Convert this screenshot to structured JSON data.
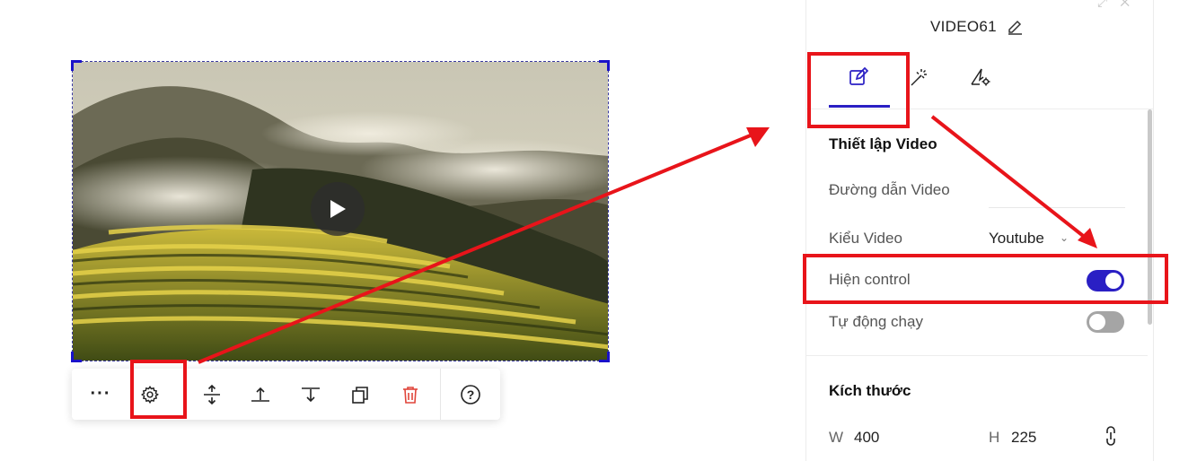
{
  "video_element": {
    "play_icon": "play-icon"
  },
  "toolbar": {
    "icons": [
      "more-icon",
      "gear-icon",
      "move-vertical-icon",
      "align-top-icon",
      "align-bottom-icon",
      "duplicate-icon",
      "trash-icon",
      "help-icon"
    ],
    "more_label": "···",
    "help_label": "?"
  },
  "panel": {
    "title": "VIDEO61",
    "tabs": [
      "edit-icon",
      "magic-wand-icon",
      "advanced-settings-icon"
    ],
    "video_settings": {
      "title": "Thiết lập Video",
      "url_label": "Đường dẫn Video",
      "url_value": "",
      "type_label": "Kiểu Video",
      "type_value": "Youtube",
      "controls_label": "Hiện control",
      "controls_on": true,
      "autoplay_label": "Tự động chạy",
      "autoplay_on": false
    },
    "size": {
      "title": "Kích thước",
      "w_label": "W",
      "w_value": "400",
      "h_label": "H",
      "h_value": "225"
    }
  },
  "colors": {
    "accent": "#2a1fc4",
    "annotation": "#e8141a",
    "delete": "#e0453a"
  }
}
